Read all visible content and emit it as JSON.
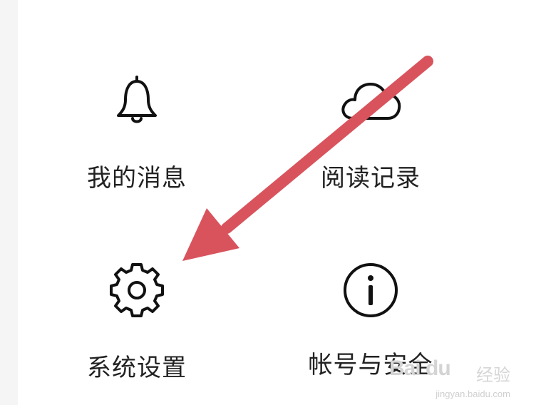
{
  "menu": {
    "items": [
      {
        "label": "我的消息",
        "icon": "bell-icon"
      },
      {
        "label": "阅读记录",
        "icon": "cloud-icon"
      },
      {
        "label": "系统设置",
        "icon": "gear-icon"
      },
      {
        "label": "帐号与安全",
        "icon": "info-icon"
      }
    ]
  },
  "annotation": {
    "arrow_color": "#d9535d",
    "arrow_target": "系统设置"
  },
  "watermark": {
    "logo": "Bai du",
    "text": "经验",
    "url": "jingyan.baidu.com"
  }
}
